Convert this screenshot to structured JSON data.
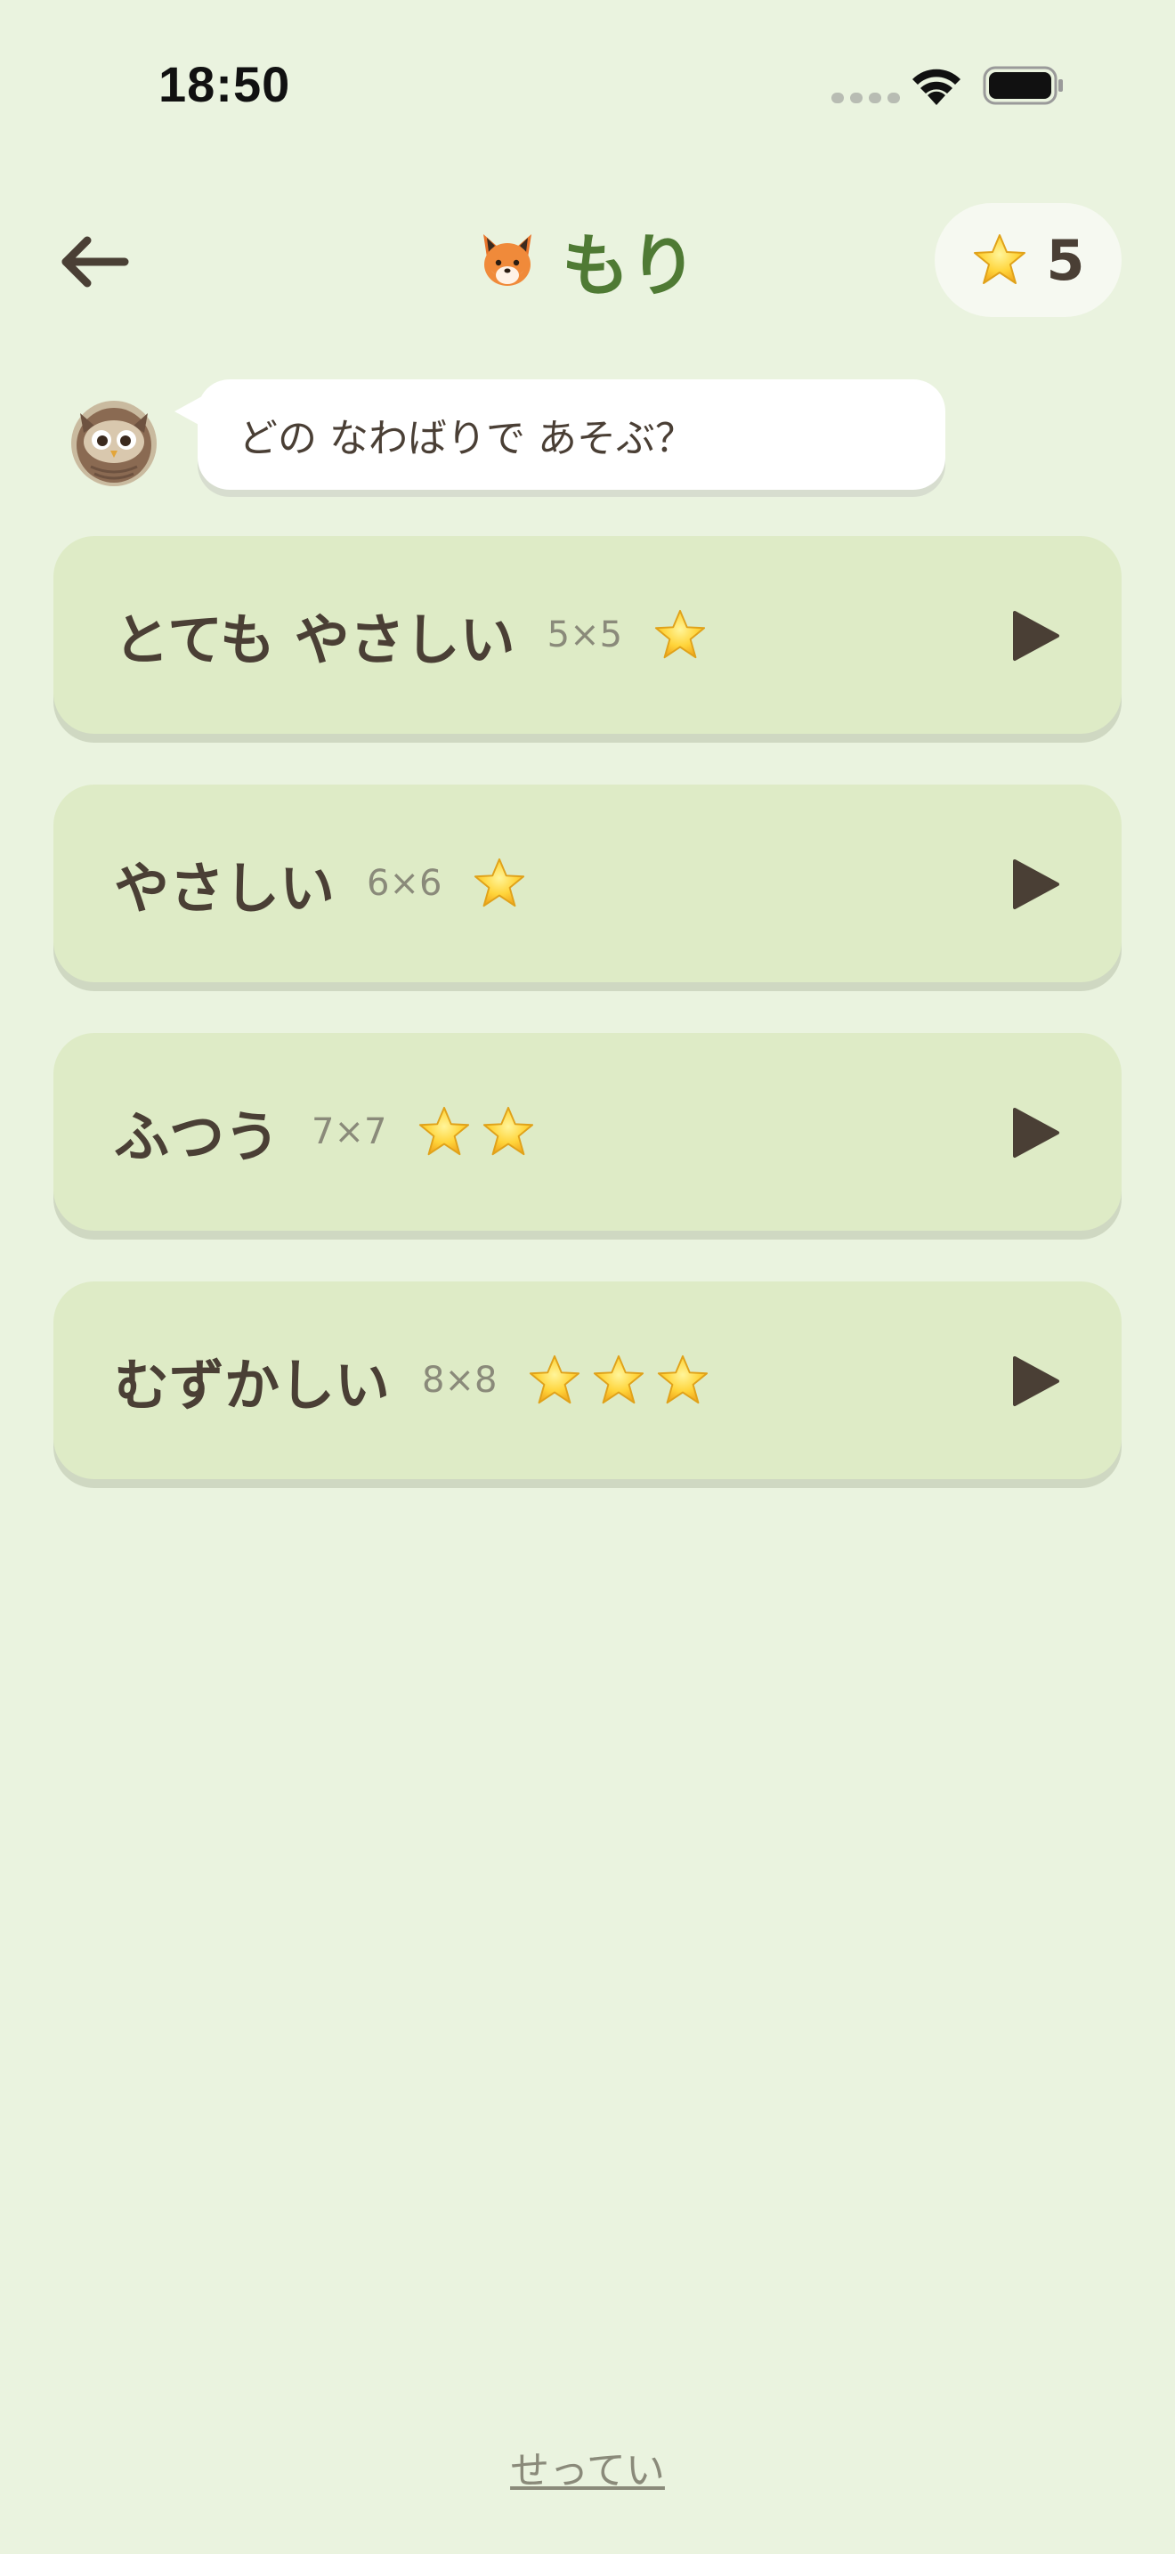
{
  "status": {
    "time": "18:50"
  },
  "header": {
    "title": "もり",
    "title_icon": "fox-face-icon",
    "star_count": "5",
    "star_icon": "star-icon",
    "back_icon": "arrow-left-icon"
  },
  "guide": {
    "avatar_icon": "owl-icon",
    "message": "どの なわばりで あそぶ？"
  },
  "levels": [
    {
      "name": "とても やさしい",
      "size": "5×5",
      "stars": 1
    },
    {
      "name": "やさしい",
      "size": "6×6",
      "stars": 1
    },
    {
      "name": "ふつう",
      "size": "7×7",
      "stars": 2
    },
    {
      "name": "むずかしい",
      "size": "8×8",
      "stars": 3
    }
  ],
  "footer": {
    "settings_label": "せってい"
  },
  "colors": {
    "background": "#eaf3df",
    "card": "#deebc6",
    "title_green": "#4f7a34",
    "text_brown": "#4a3f35",
    "star_yellow": "#f8cf2c"
  }
}
